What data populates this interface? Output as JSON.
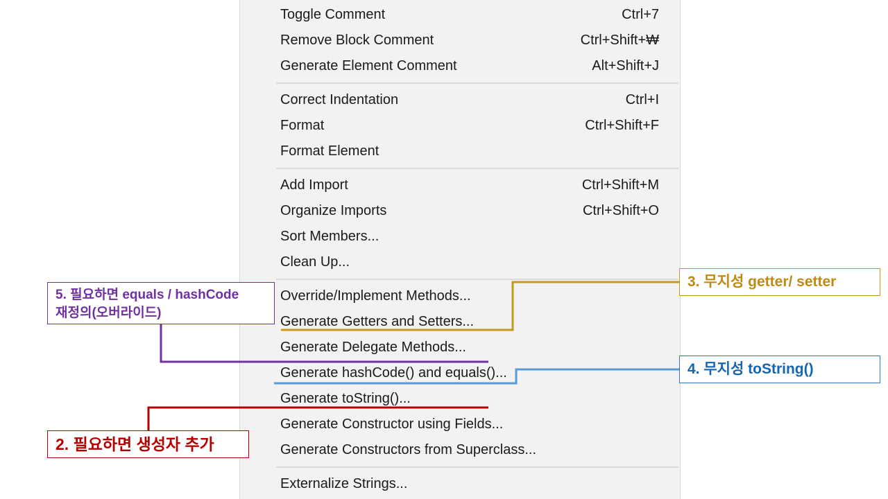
{
  "menu": {
    "groups": [
      [
        {
          "label": "Toggle Comment",
          "shortcut": "Ctrl+7"
        },
        {
          "label": "Remove Block Comment",
          "shortcut": "Ctrl+Shift+₩"
        },
        {
          "label": "Generate Element Comment",
          "shortcut": "Alt+Shift+J"
        }
      ],
      [
        {
          "label": "Correct Indentation",
          "shortcut": "Ctrl+I"
        },
        {
          "label": "Format",
          "shortcut": "Ctrl+Shift+F"
        },
        {
          "label": "Format Element",
          "shortcut": ""
        }
      ],
      [
        {
          "label": "Add Import",
          "shortcut": "Ctrl+Shift+M"
        },
        {
          "label": "Organize Imports",
          "shortcut": "Ctrl+Shift+O"
        },
        {
          "label": "Sort Members...",
          "shortcut": ""
        },
        {
          "label": "Clean Up...",
          "shortcut": ""
        }
      ],
      [
        {
          "label": "Override/Implement Methods...",
          "shortcut": ""
        },
        {
          "label": "Generate Getters and Setters...",
          "shortcut": ""
        },
        {
          "label": "Generate Delegate Methods...",
          "shortcut": ""
        },
        {
          "label": "Generate hashCode() and equals()...",
          "shortcut": ""
        },
        {
          "label": "Generate toString()...",
          "shortcut": ""
        },
        {
          "label": "Generate Constructor using Fields...",
          "shortcut": ""
        },
        {
          "label": "Generate Constructors from Superclass...",
          "shortcut": ""
        }
      ],
      [
        {
          "label": "Externalize Strings...",
          "shortcut": ""
        }
      ]
    ]
  },
  "annotations": {
    "getter_setter": {
      "text": "3. 무지성 getter/ setter",
      "color": "#c08a12"
    },
    "tostring": {
      "text": "4. 무지성 toString()",
      "color": "#1565b0"
    },
    "equals_hashcode": {
      "line1": "5. 필요하면 equals / hashCode",
      "line2": "재정의(오버라이드)",
      "color": "#7030a0"
    },
    "constructor": {
      "text": "2. 필요하면 생성자 추가",
      "color": "#b30000"
    }
  }
}
